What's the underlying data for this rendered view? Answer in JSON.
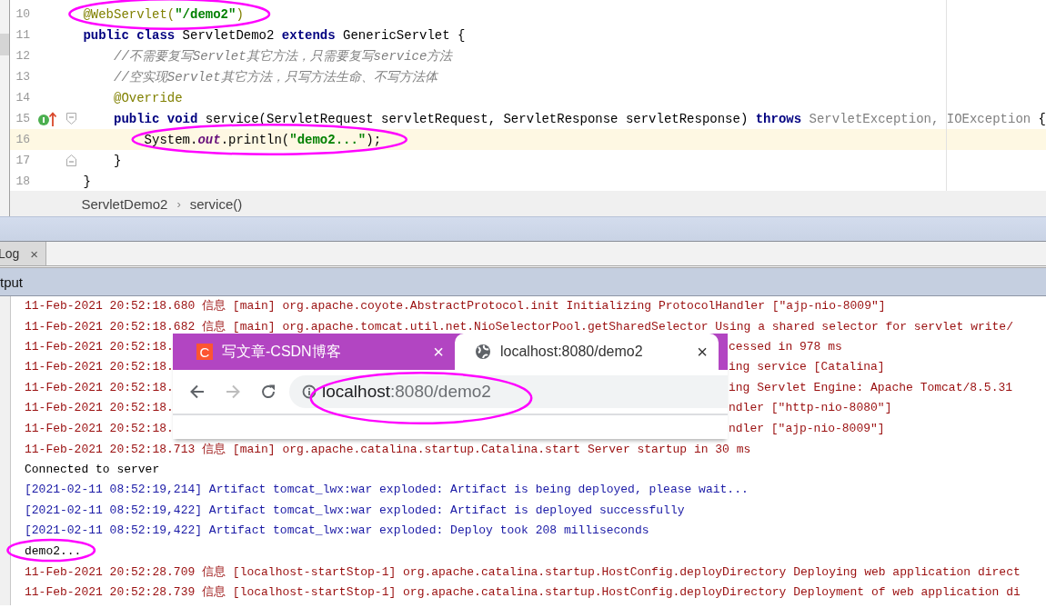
{
  "editor": {
    "lines": [
      {
        "number": "10",
        "current": false,
        "marker": false,
        "kind": "code",
        "circled": true,
        "tokens": [
          {
            "text": "@WebServlet(",
            "kind": "annotation"
          },
          {
            "text": "\"/demo2\"",
            "kind": "string"
          },
          {
            "text": ")",
            "kind": "annotation"
          }
        ]
      },
      {
        "number": "11",
        "current": false,
        "marker": false,
        "kind": "code",
        "circled": false,
        "tokens": [
          {
            "text": "public class",
            "kind": "keyword"
          },
          {
            "text": " ServletDemo2 ",
            "kind": "plain"
          },
          {
            "text": "extends",
            "kind": "keyword"
          },
          {
            "text": " GenericServlet {",
            "kind": "plain"
          }
        ]
      },
      {
        "number": "12",
        "current": false,
        "marker": false,
        "kind": "code",
        "circled": false,
        "tokens": [
          {
            "text": "    //不需要复写Servlet其它方法，只需要复写service方法",
            "kind": "comment"
          }
        ]
      },
      {
        "number": "13",
        "current": false,
        "marker": false,
        "kind": "code",
        "circled": false,
        "tokens": [
          {
            "text": "    //空实现Servlet其它方法，只写方法生命、不写方法体",
            "kind": "comment"
          }
        ]
      },
      {
        "number": "14",
        "current": false,
        "marker": false,
        "kind": "code",
        "circled": false,
        "tokens": [
          {
            "text": "    @Override",
            "kind": "annotation"
          }
        ]
      },
      {
        "number": "15",
        "current": false,
        "marker": true,
        "kind": "fold-start",
        "circled": false,
        "tokens": [
          {
            "text": "    public void",
            "kind": "keyword"
          },
          {
            "text": " service(ServletRequest servletRequest, ServletResponse servletResponse) ",
            "kind": "plain"
          },
          {
            "text": "throws",
            "kind": "keyword"
          },
          {
            "text": " ServletException, IOException",
            "kind": "unresolved"
          },
          {
            "text": " {",
            "kind": "plain"
          }
        ]
      },
      {
        "number": "16",
        "current": true,
        "marker": false,
        "kind": "code",
        "circled": true,
        "tokens": [
          {
            "text": "        System.",
            "kind": "plain"
          },
          {
            "text": "out",
            "kind": "field"
          },
          {
            "text": ".println(",
            "kind": "plain"
          },
          {
            "text": "\"demo2...\"",
            "kind": "string"
          },
          {
            "text": ");",
            "kind": "plain"
          }
        ]
      },
      {
        "number": "17",
        "current": false,
        "marker": false,
        "kind": "fold-end",
        "circled": false,
        "tokens": [
          {
            "text": "    }",
            "kind": "plain"
          }
        ]
      },
      {
        "number": "18",
        "current": false,
        "marker": false,
        "kind": "code",
        "circled": false,
        "tokens": [
          {
            "text": "}",
            "kind": "plain"
          }
        ]
      }
    ],
    "breadcrumb": {
      "items": [
        "ServletDemo2",
        "service()"
      ],
      "separator": "›"
    }
  },
  "panel": {
    "tabs": [
      {
        "label": "Log",
        "selected": true,
        "close": "×"
      }
    ],
    "header": "tput"
  },
  "console": {
    "rows": [
      {
        "kind": "info",
        "circled": false,
        "text": "11-Feb-2021 20:52:18.680 信息 [main] org.apache.coyote.AbstractProtocol.init Initializing ProtocolHandler [\"ajp-nio-8009\"]"
      },
      {
        "kind": "info",
        "circled": false,
        "text": "11-Feb-2021 20:52:18.682 信息 [main] org.apache.tomcat.util.net.NioSelectorPool.getSharedSelector Using a shared selector for servlet write/"
      },
      {
        "kind": "info",
        "text": "11-Feb-2021 20:52:18.",
        "tail": "cessed in 978 ms"
      },
      {
        "kind": "info",
        "text": "11-Feb-2021 20:52:18.",
        "tail": "ing service [Catalina]"
      },
      {
        "kind": "info",
        "text": "11-Feb-2021 20:52:18.",
        "tail": "ing Servlet Engine: Apache Tomcat/8.5.31"
      },
      {
        "kind": "info",
        "text": "11-Feb-2021 20:52:18.",
        "tail": "ndler [\"http-nio-8080\"]"
      },
      {
        "kind": "info",
        "text": "11-Feb-2021 20:52:18.",
        "tail": "ndler [\"ajp-nio-8009\"]"
      },
      {
        "kind": "info",
        "circled": false,
        "text": "11-Feb-2021 20:52:18.713 信息 [main] org.apache.catalina.startup.Catalina.start Server startup in 30 ms"
      },
      {
        "kind": "plain",
        "circled": false,
        "text": "Connected to server"
      },
      {
        "kind": "artifact",
        "circled": false,
        "text": "[2021-02-11 08:52:19,214] Artifact tomcat_lwx:war exploded: Artifact is being deployed, please wait..."
      },
      {
        "kind": "artifact",
        "circled": false,
        "text": "[2021-02-11 08:52:19,422] Artifact tomcat_lwx:war exploded: Artifact is deployed successfully"
      },
      {
        "kind": "artifact",
        "circled": false,
        "text": "[2021-02-11 08:52:19,422] Artifact tomcat_lwx:war exploded: Deploy took 208 milliseconds"
      },
      {
        "kind": "plain",
        "circled": true,
        "text": "demo2..."
      },
      {
        "kind": "info",
        "circled": false,
        "text": "11-Feb-2021 20:52:28.709 信息 [localhost-startStop-1] org.apache.catalina.startup.HostConfig.deployDirectory Deploying web application direct"
      },
      {
        "kind": "info",
        "circled": false,
        "text": "11-Feb-2021 20:52:28.739 信息 [localhost-startStop-1] org.apache.catalina.startup.HostConfig.deployDirectory Deployment of web application di"
      }
    ]
  },
  "browser": {
    "tabs": [
      {
        "kind": "site-logo",
        "logo": "C",
        "title": "写文章-CSDN博客",
        "close": "×",
        "selected": false
      },
      {
        "kind": "globe",
        "title": "localhost:8080/demo2",
        "close": "×",
        "selected": true
      }
    ],
    "nav": [
      {
        "kind": "back",
        "disabled": false
      },
      {
        "kind": "forward",
        "disabled": true
      },
      {
        "kind": "reload",
        "disabled": false
      }
    ],
    "address": {
      "host": "localhost",
      "rest": ":8080/demo2",
      "circled": true
    }
  }
}
